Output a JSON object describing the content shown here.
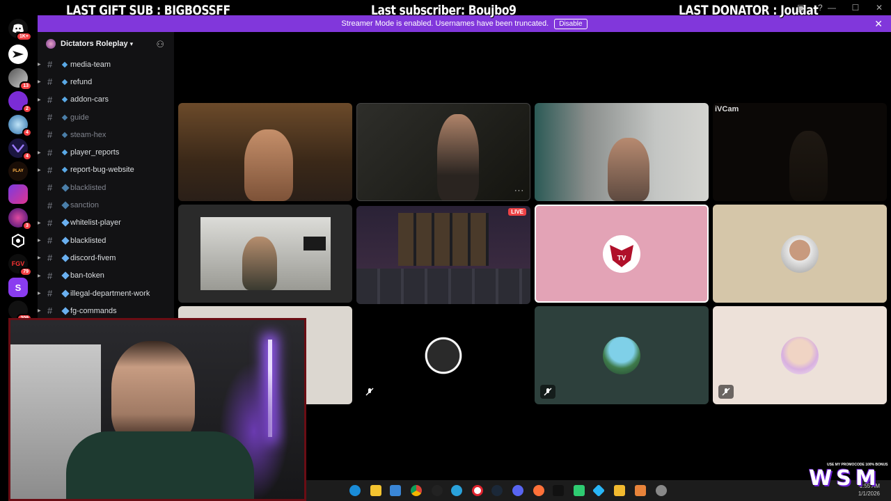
{
  "overlay": {
    "last_gift_sub": "LAST GIFT SUB : BIGBOSSFF",
    "last_subscriber": "Last subscriber: Boujbo9",
    "last_donator": "LAST DONATOR : Joudat"
  },
  "streamer_banner": {
    "text": "Streamer Mode is enabled. Usernames have been truncated.",
    "button": "Disable",
    "color": "#8137db"
  },
  "server_rail": {
    "items": [
      {
        "name": "discord-home-icon",
        "badge": "1K+"
      },
      {
        "name": "server-1",
        "badge": ""
      },
      {
        "name": "server-2",
        "badge": "13"
      },
      {
        "name": "server-3",
        "badge": "2"
      },
      {
        "name": "server-4",
        "badge": "4"
      },
      {
        "name": "server-5",
        "badge": "4"
      },
      {
        "name": "server-6",
        "badge": ""
      },
      {
        "name": "server-7",
        "badge": ""
      },
      {
        "name": "server-8",
        "badge": "3"
      },
      {
        "name": "server-9",
        "badge": ""
      },
      {
        "name": "server-10",
        "badge": "79"
      },
      {
        "name": "server-11",
        "badge": ""
      },
      {
        "name": "server-12",
        "badge": "209"
      }
    ]
  },
  "guild": {
    "name": "Dictators Roleplay"
  },
  "channels": [
    {
      "label": "media-team",
      "muted": false,
      "big": false
    },
    {
      "label": "refund",
      "muted": false,
      "big": false
    },
    {
      "label": "addon-cars",
      "muted": false,
      "big": false
    },
    {
      "label": "guide",
      "muted": true,
      "big": false
    },
    {
      "label": "steam-hex",
      "muted": true,
      "big": false
    },
    {
      "label": "player_reports",
      "muted": false,
      "big": false
    },
    {
      "label": "report-bug-website",
      "muted": false,
      "big": false
    },
    {
      "label": "blacklisted",
      "muted": true,
      "big": true
    },
    {
      "label": "sanction",
      "muted": true,
      "big": true
    },
    {
      "label": "whitelist-player",
      "muted": false,
      "big": true
    },
    {
      "label": "blacklisted",
      "muted": false,
      "big": true
    },
    {
      "label": "discord-fivem",
      "muted": false,
      "big": true
    },
    {
      "label": "ban-token",
      "muted": false,
      "big": true
    },
    {
      "label": "illegal-department-work",
      "muted": false,
      "big": true
    },
    {
      "label": "fg-commands",
      "muted": false,
      "big": true
    }
  ],
  "tiles": {
    "ivcam_label": "iVCam",
    "live_label": "LIVE",
    "more_label": "···"
  },
  "taskbar": {
    "time": "1:55 AM",
    "date": "1/1/2026"
  },
  "brand": {
    "logo": "WSM",
    "promo": "USE MY PROMOCODE 100% BONUS"
  }
}
